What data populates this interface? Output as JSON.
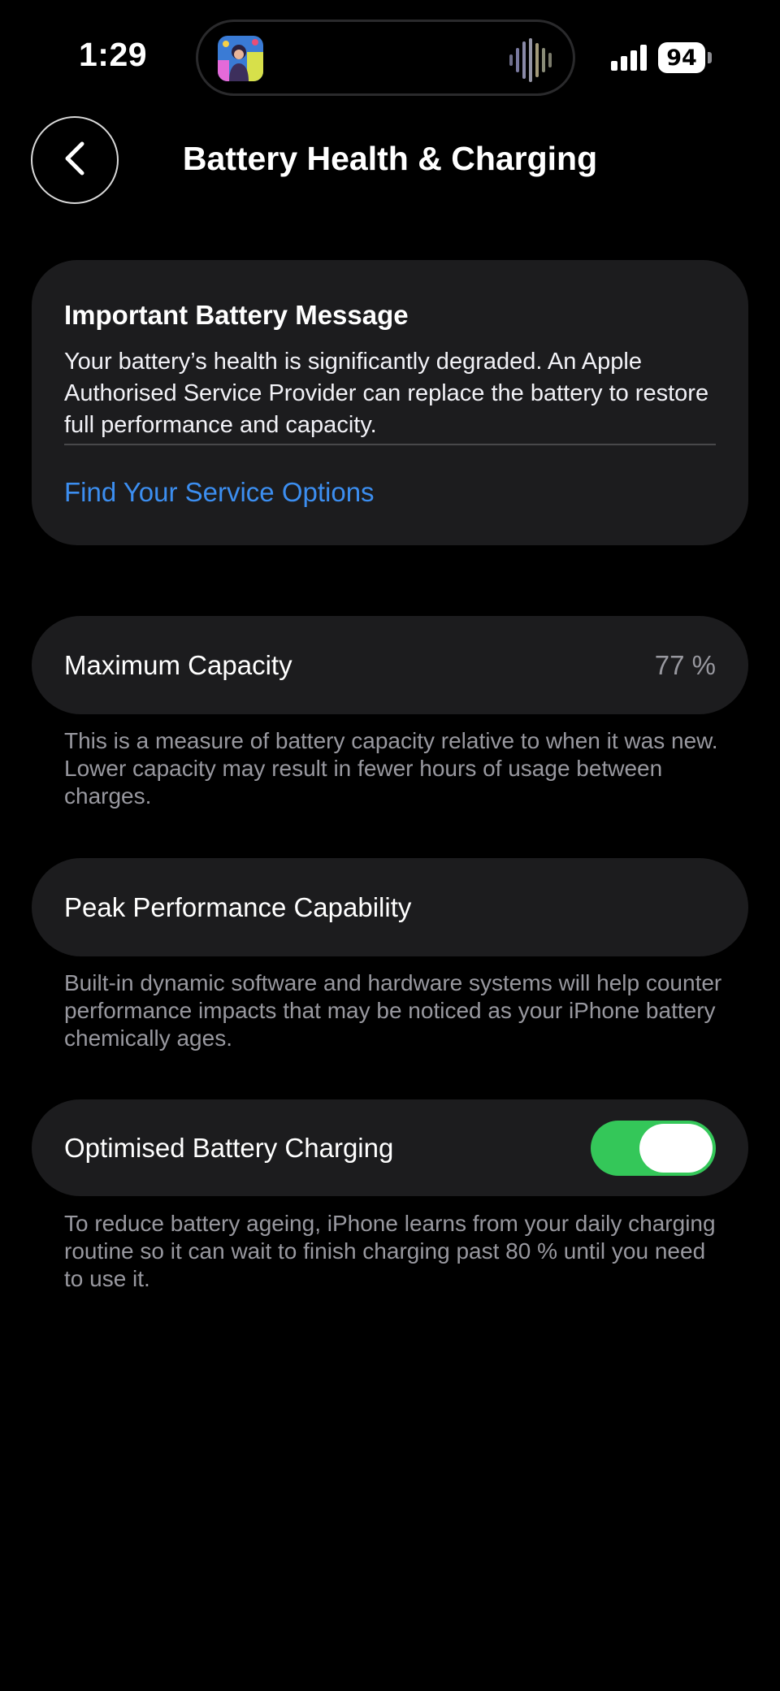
{
  "status_bar": {
    "time": "1:29",
    "battery_level": "94",
    "signal_icon": "cellular-signal-icon",
    "now_playing_art": "album-art",
    "now_playing_icon": "audio-waveform-icon"
  },
  "header": {
    "title": "Battery Health & Charging",
    "back_icon": "chevron-left-icon"
  },
  "message_card": {
    "title": "Important Battery Message",
    "body": "Your battery’s health is significantly degraded. An Apple Authorised Service Provider can replace the battery to restore full performance and capacity.",
    "link": "Find Your Service Options"
  },
  "max_capacity": {
    "label": "Maximum Capacity",
    "value": "77 %",
    "footnote": "This is a measure of battery capacity relative to when it was new. Lower capacity may result in fewer hours of usage between charges."
  },
  "peak_performance": {
    "label": "Peak Performance Capability",
    "footnote": "Built-in dynamic software and hardware systems will help counter performance impacts that may be noticed as your iPhone battery chemically ages."
  },
  "optimised_charging": {
    "label": "Optimised Battery Charging",
    "enabled": true,
    "footnote": "To reduce battery ageing, iPhone learns from your daily charging routine so it can wait to finish charging past 80 % until you need to use it."
  },
  "colors": {
    "background": "#000000",
    "card": "#1c1c1e",
    "link": "#3c8ef0",
    "toggle_on": "#34c759",
    "secondary_text": "#98989f"
  }
}
